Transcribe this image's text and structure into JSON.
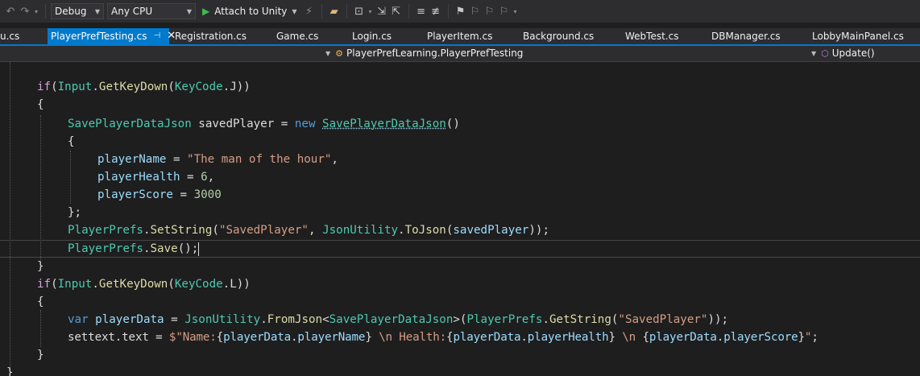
{
  "toolbar": {
    "configuration": "Debug",
    "platform": "Any CPU",
    "attach_label": "Attach to Unity"
  },
  "tabs": [
    {
      "label": "u.cs"
    },
    {
      "label": "PlayerPrefTesting.cs"
    },
    {
      "label": "Registration.cs"
    },
    {
      "label": "Game.cs"
    },
    {
      "label": "Login.cs"
    },
    {
      "label": "PlayerItem.cs"
    },
    {
      "label": "Background.cs"
    },
    {
      "label": "WebTest.cs"
    },
    {
      "label": "DBManager.cs"
    },
    {
      "label": "LobbyMainPanel.cs"
    }
  ],
  "navbar": {
    "type_label": "PlayerPrefLearning.PlayerPrefTesting",
    "member_label": "Update()"
  },
  "code": {
    "t1": "if",
    "t2": "(",
    "t3": "Input",
    "t4": ".",
    "t5": "GetKeyDown",
    "t6": "(",
    "t7": "KeyCode",
    "t8": ".J))",
    "t9": "{",
    "t10": "SavePlayerDataJson",
    "t11": " savedPlayer = ",
    "t12": "new",
    "t13": " ",
    "t14": "SavePlayerDataJson",
    "t15": "()",
    "t16": "{",
    "t17": "playerName",
    "t18": " = ",
    "t19": "\"The man of the hour\"",
    "t20": ",",
    "t21": "playerHealth",
    "t22": " = ",
    "t23": "6",
    "t24": ",",
    "t25": "playerScore",
    "t26": " = ",
    "t27": "3000",
    "t28": "};",
    "t29": "PlayerPrefs",
    "t30": ".",
    "t31": "SetString",
    "t32": "(",
    "t33": "\"SavedPlayer\"",
    "t34": ", ",
    "t35": "JsonUtility",
    "t36": ".",
    "t37": "ToJson",
    "t38": "(",
    "t39": "savedPlayer",
    "t40": "));",
    "t41": "PlayerPrefs",
    "t42": ".",
    "t43": "Save",
    "t44": "();",
    "t45": "}",
    "t46": "if",
    "t47": "(",
    "t48": "Input",
    "t49": ".",
    "t50": "GetKeyDown",
    "t51": "(",
    "t52": "KeyCode",
    "t53": ".L))",
    "t54": "{",
    "t55": "var",
    "t56": " ",
    "t57": "playerData",
    "t58": " = ",
    "t59": "JsonUtility",
    "t60": ".",
    "t61": "FromJson",
    "t62": "<",
    "t63": "SavePlayerDataJson",
    "t64": ">(",
    "t65": "PlayerPrefs",
    "t66": ".",
    "t67": "GetString",
    "t68": "(",
    "t69": "\"SavedPlayer\"",
    "t70": "));",
    "t71": "settext",
    "t72": ".",
    "t73": "text",
    "t74": " = ",
    "t75": "$\"Name:",
    "t76": "{",
    "t77": "playerData",
    "t78": ".",
    "t79": "playerName",
    "t80": "}",
    "t81": " \\n Health:",
    "t82": "{",
    "t83": "playerData",
    "t84": ".",
    "t85": "playerHealth",
    "t86": "}",
    "t87": " \\n ",
    "t88": "{",
    "t89": "playerData",
    "t90": ".",
    "t91": "playerScore",
    "t92": "}",
    "t93": "\"",
    "t94": ";",
    "t95": "}",
    "t96": "}"
  }
}
